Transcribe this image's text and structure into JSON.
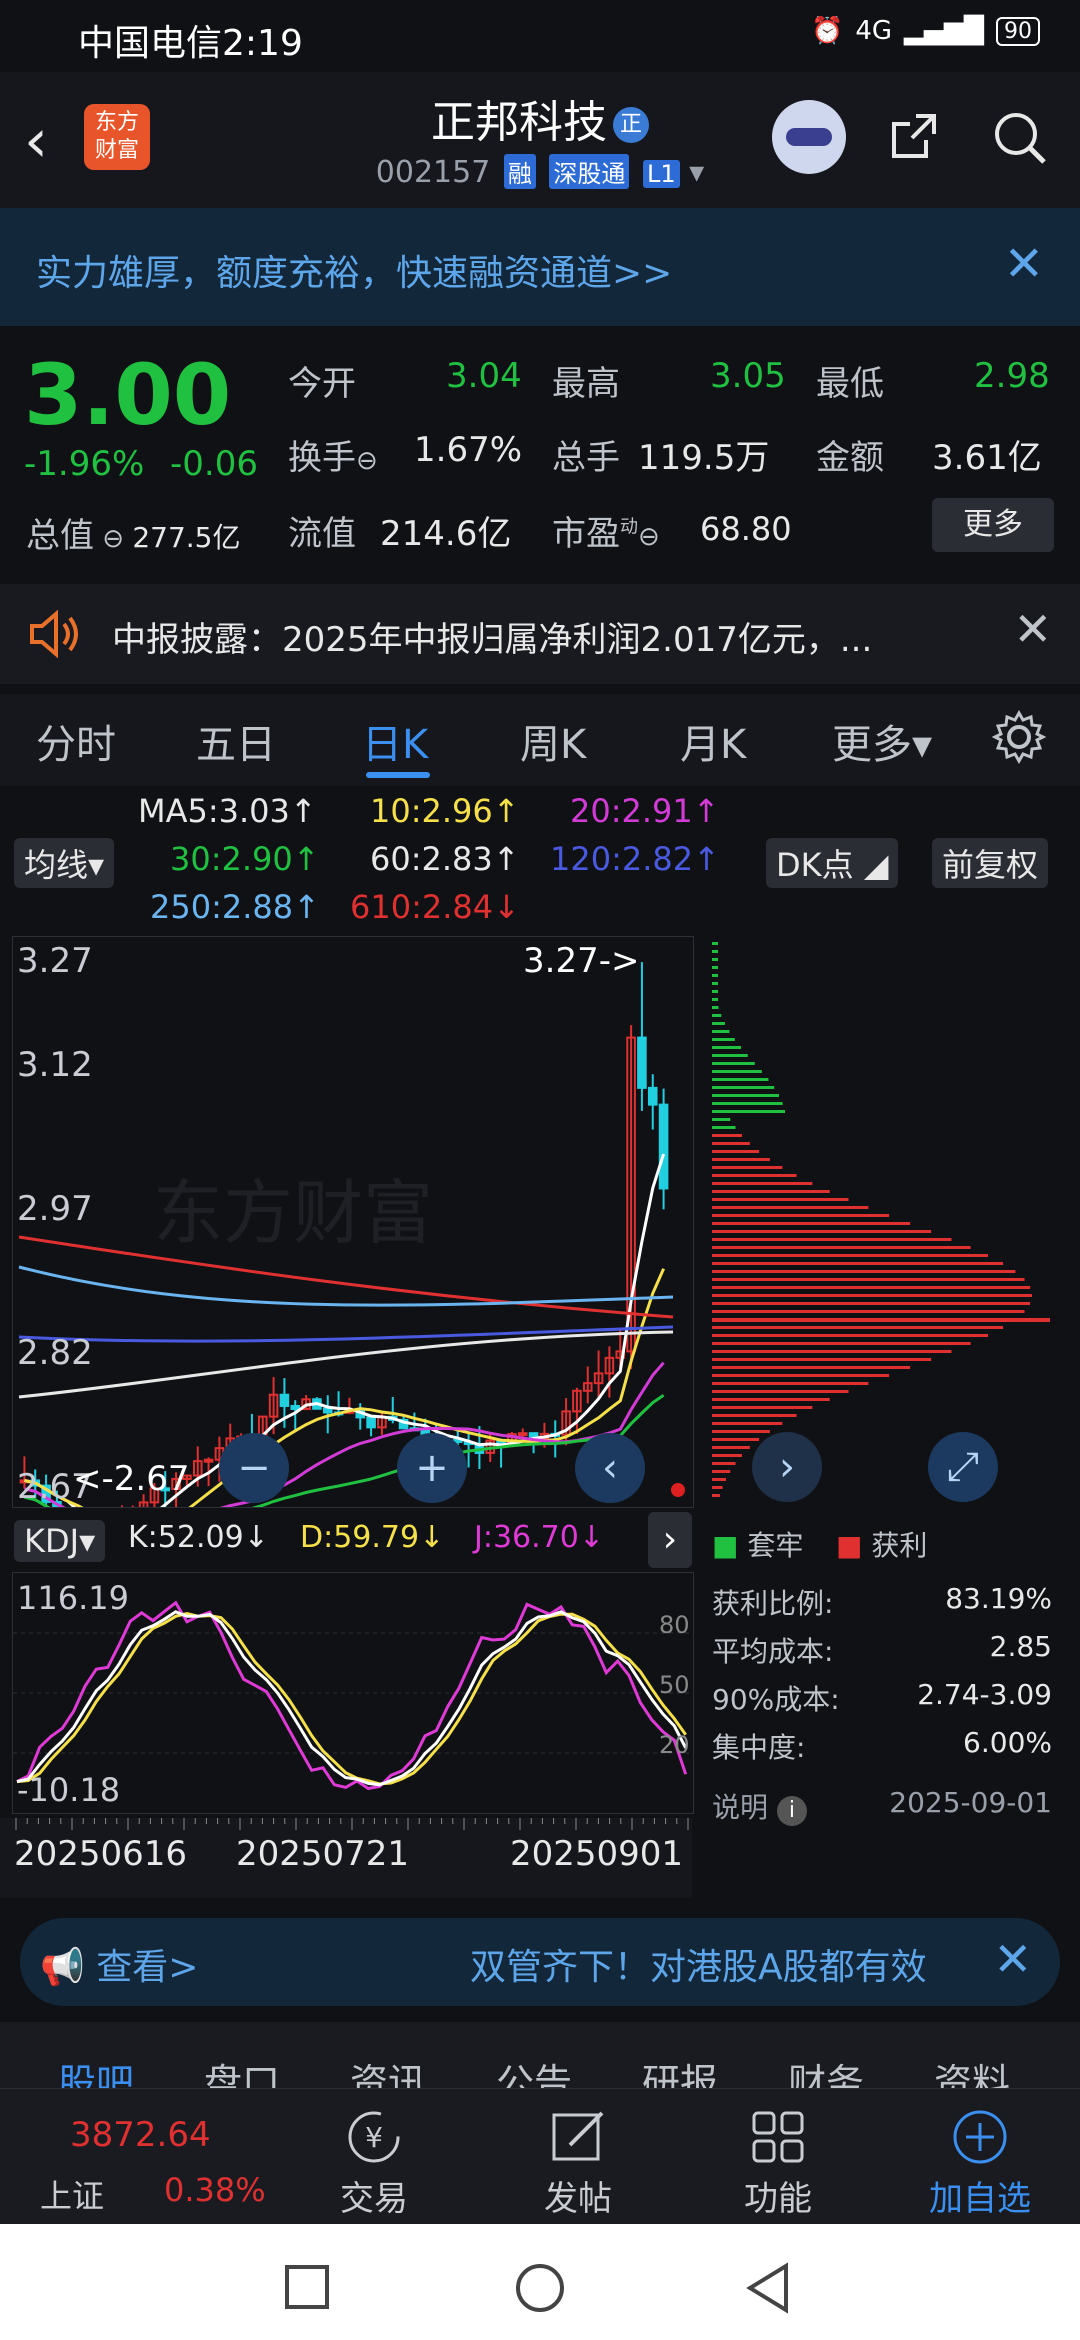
{
  "status_bar": {
    "carrier_time": "中国电信2:19",
    "network": "4G",
    "battery": "90"
  },
  "header": {
    "logo_line1": "东方",
    "logo_line2": "财富",
    "stock_name": "正邦科技",
    "name_badge": "正",
    "stock_code": "002157",
    "tag_rong": "融",
    "tag_sgt": "深股通",
    "tag_level": "L1"
  },
  "banner": {
    "text": "实力雄厚，额度充裕，快速融资通道>>"
  },
  "quote": {
    "price": "3.00",
    "change_pct": "-1.96%",
    "change_amt": "-0.06",
    "open_label": "今开",
    "open": "3.04",
    "high_label": "最高",
    "high": "3.05",
    "low_label": "最低",
    "low": "2.98",
    "turnover_label": "换手",
    "turnover": "1.67%",
    "volume_label": "总手",
    "volume": "119.5万",
    "amount_label": "金额",
    "amount": "3.61亿",
    "mktcap_label": "总值",
    "mktcap": "277.5亿",
    "float_label": "流值",
    "float_cap": "214.6亿",
    "pe_label": "市盈",
    "pe_sup": "动",
    "pe": "68.80",
    "more_label": "更多"
  },
  "notice": {
    "text": "中报披露：2025年中报归属净利润2.017亿元，..."
  },
  "tabs": [
    {
      "label": "分时"
    },
    {
      "label": "五日"
    },
    {
      "label": "日K"
    },
    {
      "label": "周K"
    },
    {
      "label": "月K"
    },
    {
      "label": "更多▾"
    }
  ],
  "ma": {
    "selector": "均线▾",
    "dk": "DK点",
    "fq": "前复权",
    "ma5": "MA5:3.03↑",
    "ma10": "10:2.96↑",
    "ma20": "20:2.91↑",
    "ma30": "30:2.90↑",
    "ma60": "60:2.83↑",
    "ma120": "120:2.82↑",
    "ma250": "250:2.88↑",
    "ma610": "610:2.84↓",
    "c_ma5": "#ffffff",
    "c_ma10": "#f5e04a",
    "c_ma20": "#d23bd6",
    "c_ma30": "#20c040",
    "c_ma60": "#e8e8e8",
    "c_ma120": "#4a5ae0",
    "c_ma250": "#6ab4f0",
    "c_ma610": "#e03030"
  },
  "chart": {
    "y_labels": [
      "3.27",
      "3.12",
      "2.97",
      "2.82",
      "2.67"
    ],
    "high_marker": "3.27->",
    "low_marker": "<-2.67",
    "watermark": "东方财富"
  },
  "profit_dist": {
    "legend_hold": "套牢",
    "legend_profit": "获利",
    "rows": [
      {
        "label": "获利比例:",
        "value": "83.19%"
      },
      {
        "label": "平均成本:",
        "value": "2.85"
      },
      {
        "label": "90%成本:",
        "value": "2.74-3.09"
      },
      {
        "label": "集中度:",
        "value": "6.00%"
      }
    ],
    "note_label": "说明",
    "date": "2025-09-01"
  },
  "kdj": {
    "selector": "KDJ▾",
    "k": "K:52.09↓",
    "d": "D:59.79↓",
    "j": "J:36.70↓",
    "y_top": "116.19",
    "y_bottom": "-10.18",
    "ref80": "80",
    "ref50": "50",
    "ref20": "20"
  },
  "x_dates": [
    "20250616",
    "20250721",
    "20250901"
  ],
  "ad": {
    "left": "查看>",
    "text": "双管齐下！对港股A股都有效"
  },
  "sub_tabs": [
    "股吧",
    "盘口",
    "资讯",
    "公告",
    "研报",
    "财务",
    "资料"
  ],
  "bottom_bar": {
    "index_value": "3872.64",
    "index_name": "上证",
    "index_pct": "0.38%",
    "trade": "交易",
    "post": "发帖",
    "func": "功能",
    "add": "加自选"
  }
}
